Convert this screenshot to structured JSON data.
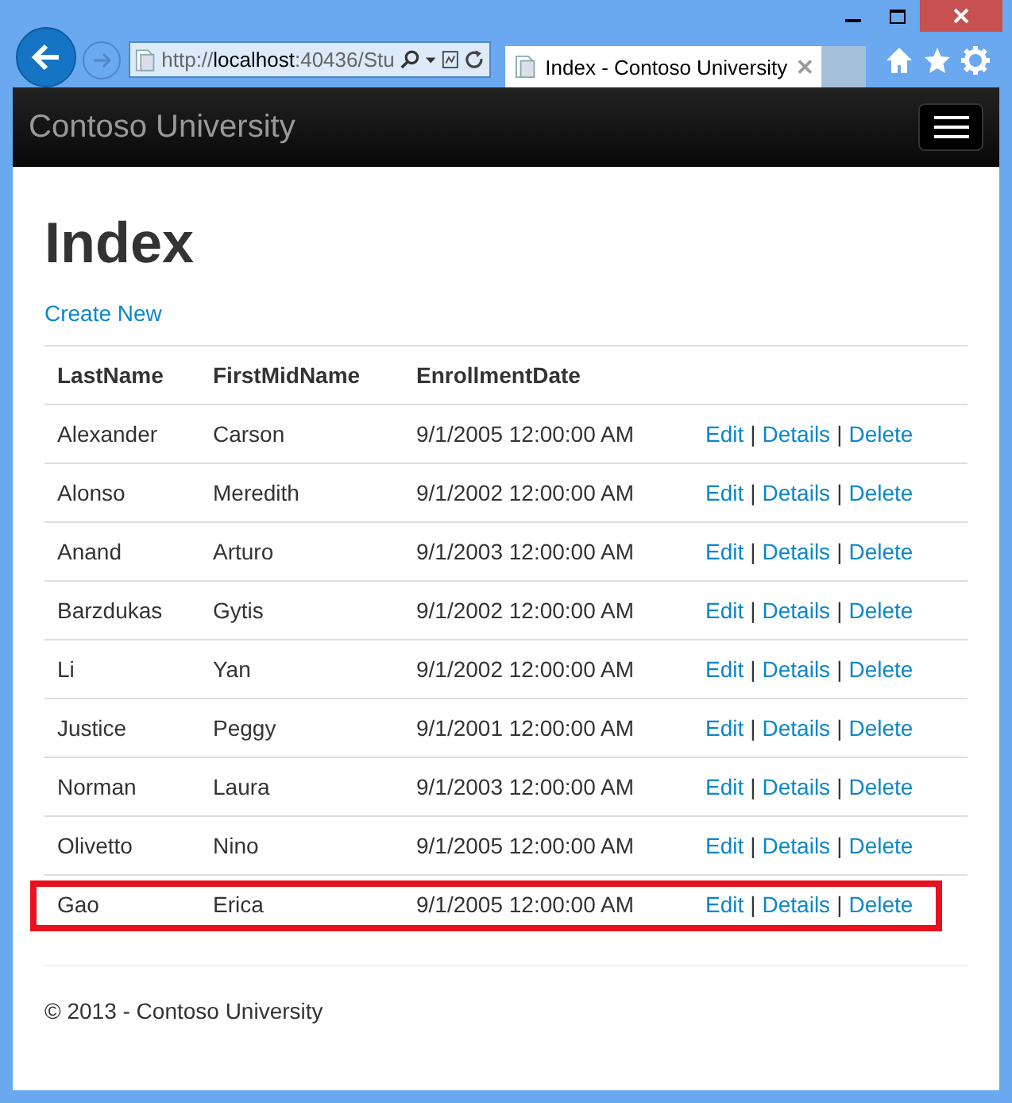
{
  "browser": {
    "address": "http://**localhost**:40436/Stu",
    "tabs": [
      {
        "title": "Index - Contoso University",
        "selected": true
      }
    ]
  },
  "navbar": {
    "brand": "Contoso University"
  },
  "page": {
    "heading": "Index",
    "create_link": "Create New",
    "table": {
      "columns": [
        "LastName",
        "FirstMidName",
        "EnrollmentDate"
      ],
      "separator": "|",
      "rows": [
        {
          "last_name": "Alexander",
          "first_mid_name": "Carson",
          "enrollment_date": "9/1/2005 12:00:00 AM",
          "actions": [
            "Edit",
            "Details",
            "Delete"
          ],
          "highlighted": false
        },
        {
          "last_name": "Alonso",
          "first_mid_name": "Meredith",
          "enrollment_date": "9/1/2002 12:00:00 AM",
          "actions": [
            "Edit",
            "Details",
            "Delete"
          ],
          "highlighted": false
        },
        {
          "last_name": "Anand",
          "first_mid_name": "Arturo",
          "enrollment_date": "9/1/2003 12:00:00 AM",
          "actions": [
            "Edit",
            "Details",
            "Delete"
          ],
          "highlighted": false
        },
        {
          "last_name": "Barzdukas",
          "first_mid_name": "Gytis",
          "enrollment_date": "9/1/2002 12:00:00 AM",
          "actions": [
            "Edit",
            "Details",
            "Delete"
          ],
          "highlighted": false
        },
        {
          "last_name": "Li",
          "first_mid_name": "Yan",
          "enrollment_date": "9/1/2002 12:00:00 AM",
          "actions": [
            "Edit",
            "Details",
            "Delete"
          ],
          "highlighted": false
        },
        {
          "last_name": "Justice",
          "first_mid_name": "Peggy",
          "enrollment_date": "9/1/2001 12:00:00 AM",
          "actions": [
            "Edit",
            "Details",
            "Delete"
          ],
          "highlighted": false
        },
        {
          "last_name": "Norman",
          "first_mid_name": "Laura",
          "enrollment_date": "9/1/2003 12:00:00 AM",
          "actions": [
            "Edit",
            "Details",
            "Delete"
          ],
          "highlighted": false
        },
        {
          "last_name": "Olivetto",
          "first_mid_name": "Nino",
          "enrollment_date": "9/1/2005 12:00:00 AM",
          "actions": [
            "Edit",
            "Details",
            "Delete"
          ],
          "highlighted": false
        },
        {
          "last_name": "Gao",
          "first_mid_name": "Erica",
          "enrollment_date": "9/1/2005 12:00:00 AM",
          "actions": [
            "Edit",
            "Details",
            "Delete"
          ],
          "highlighted": true
        }
      ]
    }
  },
  "footer": {
    "text": "© 2013 - Contoso University"
  }
}
